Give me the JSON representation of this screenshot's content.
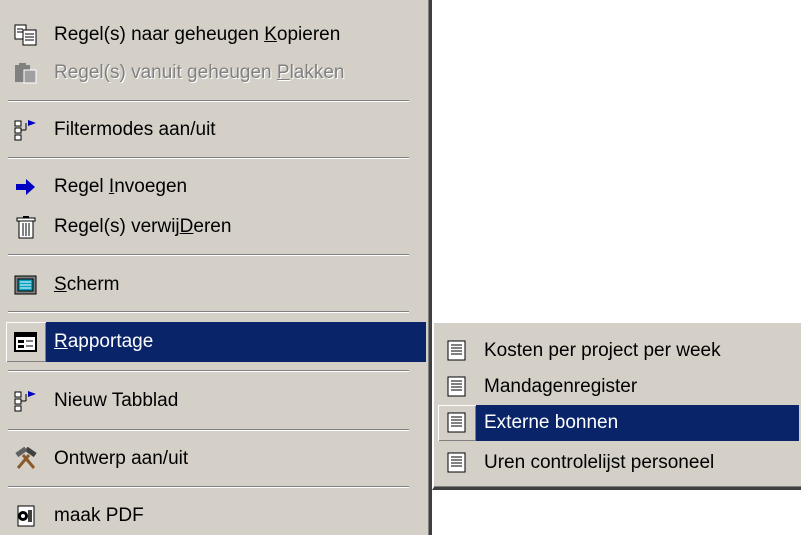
{
  "menu": {
    "items": [
      {
        "pre": "Regel(s) naar geheugen ",
        "key": "K",
        "post": "opieren",
        "icon": "copy-icon",
        "disabled": false
      },
      {
        "pre": "Regel(s) vanuit geheugen ",
        "key": "P",
        "post": "lakken",
        "icon": "paste-icon",
        "disabled": true
      },
      {
        "pre": "Filtermodes aan/uit",
        "key": "",
        "post": "",
        "icon": "filter-tree-icon",
        "disabled": false
      },
      {
        "pre": "Regel ",
        "key": "I",
        "post": "nvoegen",
        "icon": "insert-arrow-icon",
        "disabled": false
      },
      {
        "pre": "Regel(s) verwij",
        "key": "D",
        "post": "eren",
        "icon": "trash-icon",
        "disabled": false
      },
      {
        "pre": "",
        "key": "S",
        "post": "cherm",
        "icon": "screen-icon",
        "disabled": false
      },
      {
        "pre": "",
        "key": "R",
        "post": "apportage",
        "icon": "report-icon",
        "disabled": false,
        "selected": true
      },
      {
        "pre": "Nieuw Tabblad",
        "key": "",
        "post": "",
        "icon": "tree-tab-icon",
        "disabled": false
      },
      {
        "pre": "Ontwerp aan/uit",
        "key": "",
        "post": "",
        "icon": "hammer-icon",
        "disabled": false
      },
      {
        "pre": "maak PDF",
        "key": "",
        "post": "",
        "icon": "pdf-icon",
        "disabled": false
      }
    ]
  },
  "submenu": {
    "items": [
      {
        "label": "Kosten per project per week",
        "icon": "document-icon"
      },
      {
        "label": "Mandagenregister",
        "icon": "document-icon"
      },
      {
        "label": "Externe bonnen",
        "icon": "document-icon",
        "selected": true
      },
      {
        "label": "Uren controlelijst personeel",
        "icon": "document-icon"
      }
    ]
  },
  "colors": {
    "menu_bg": "#d4d0c8",
    "highlight": "#0a246a",
    "disabled_text": "#808080"
  }
}
